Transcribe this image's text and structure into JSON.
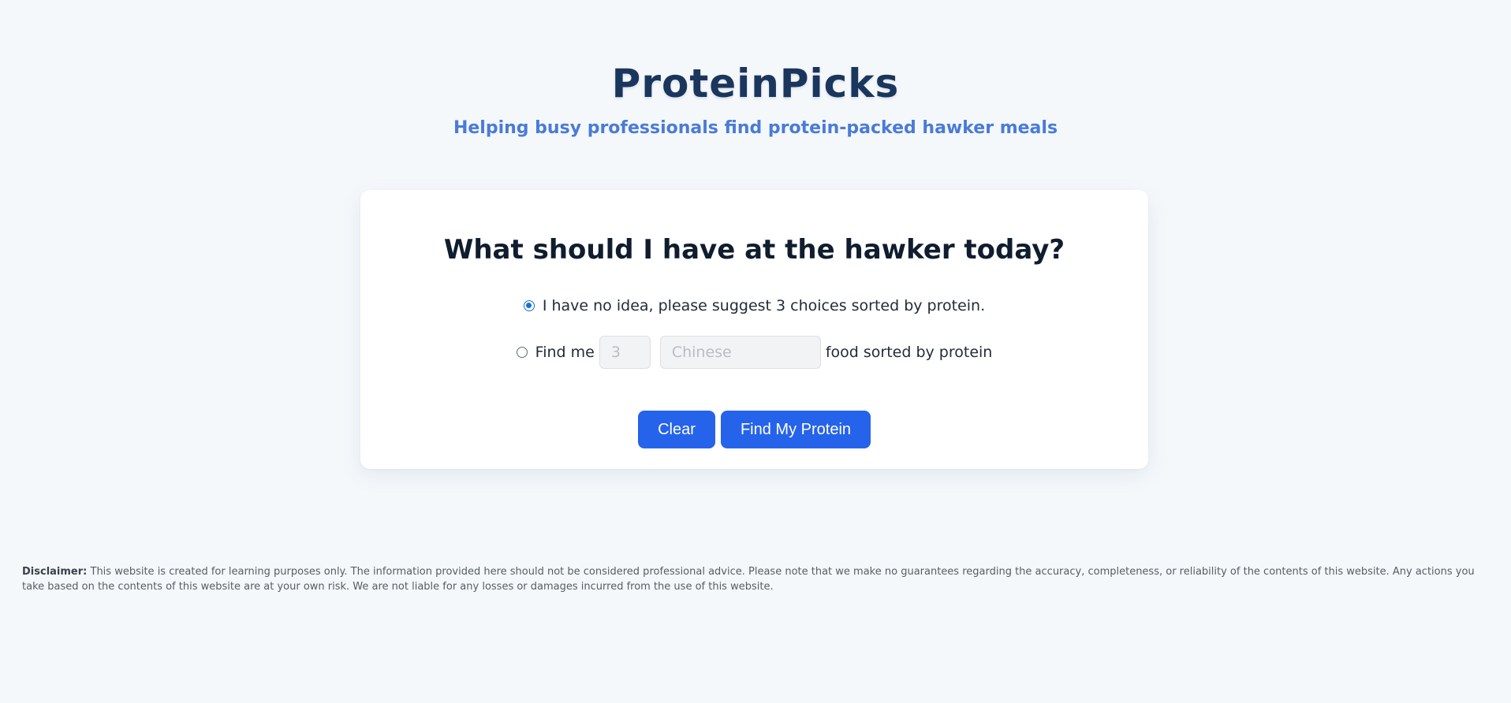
{
  "header": {
    "title": "ProteinPicks",
    "subtitle": "Helping busy professionals find protein-packed hawker meals"
  },
  "form": {
    "question": "What should I have at the hawker today?",
    "option_suggest": {
      "label": "I have no idea, please suggest 3 choices sorted by protein.",
      "selected": true
    },
    "option_find": {
      "prefix": "Find me",
      "count_placeholder": "3",
      "cuisine_placeholder": "Chinese",
      "suffix": "food sorted by protein",
      "selected": false
    },
    "buttons": {
      "clear_label": "Clear",
      "find_label": "Find My Protein"
    }
  },
  "footer": {
    "disclaimer_label": "Disclaimer:",
    "disclaimer_text": "This website is created for learning purposes only. The information provided here should not be considered professional advice. Please note that we make no guarantees regarding the accuracy, completeness, or reliability of the contents of this website. Any actions you take based on the contents of this website are at your own risk. We are not liable for any losses or damages incurred from the use of this website."
  },
  "colors": {
    "background": "#f5f8fb",
    "title": "#1b365d",
    "subtitle": "#4a7bd8",
    "button": "#2563eb",
    "radio_checked": "#1d6fd6"
  }
}
